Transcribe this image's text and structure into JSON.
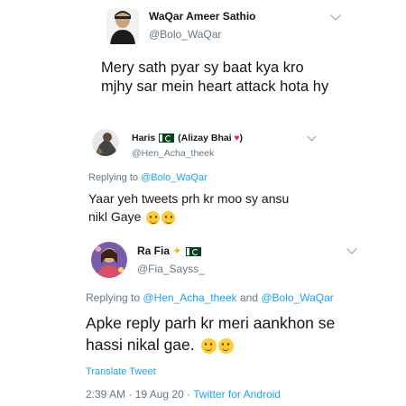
{
  "tweet1": {
    "name": "WaQar Ameer Sathio",
    "handle": "@Bolo_WaQar",
    "text": "Mery sath pyar sy baat kya kro mjhy sar mein heart attack hota hy"
  },
  "tweet2": {
    "name": "Haris",
    "name_suffix": "(Alizay Bhai",
    "name_close": ")",
    "handle": "@Hen_Acha_theek",
    "replying_prefix": "Replying to",
    "replying_to": "@Bolo_WaQar",
    "text": "Yaar yeh tweets prh kr moo sy ansu nikl Gaye"
  },
  "tweet3": {
    "name": "Ra Fia",
    "handle": "@Fia_Sayss_",
    "replying_prefix": "Replying to",
    "replying_to_1": "@Hen_Acha_theek",
    "replying_and": "and",
    "replying_to_2": "@Bolo_WaQar",
    "text": "Apke reply parh kr meri aankhon se hassi nikal gae.",
    "translate": "Translate Tweet",
    "time": "2:39 AM",
    "date": "19 Aug 20",
    "source": "Twitter for Android"
  },
  "icons": {
    "flag": "pakistan-flag-icon",
    "sparkle": "sparkle-icon",
    "heart": "heart-icon",
    "chevron": "chevron-down-icon",
    "emoji": "smile-emoji-icon"
  },
  "colors": {
    "link": "#1da1f2",
    "secondary": "#657786",
    "text": "#14171a"
  }
}
